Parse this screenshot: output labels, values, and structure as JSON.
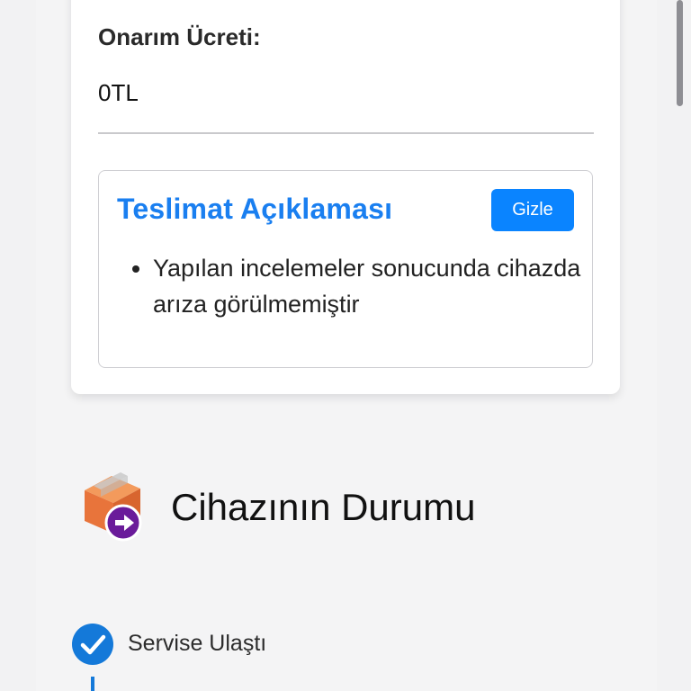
{
  "repair": {
    "fee_label": "Onarım Ücreti:",
    "fee_value": "0TL"
  },
  "delivery": {
    "title": "Teslimat Açıklaması",
    "hide_button": "Gizle",
    "items": [
      "Yapılan incelemeler sonucunda cihazda arıza görülmemiştir"
    ]
  },
  "status_section": {
    "title": "Cihazının Durumu",
    "icon": "box-arrow-icon"
  },
  "steps": [
    {
      "label": "Servise Ulaştı",
      "state": "completed",
      "icon": "check-circle-icon"
    }
  ],
  "colors": {
    "accent_blue": "#1a7ff0",
    "button_blue": "#0a84ff",
    "step_blue": "#1479d9",
    "box_orange": "#e8743b",
    "arrow_purple": "#6a1b9a"
  }
}
